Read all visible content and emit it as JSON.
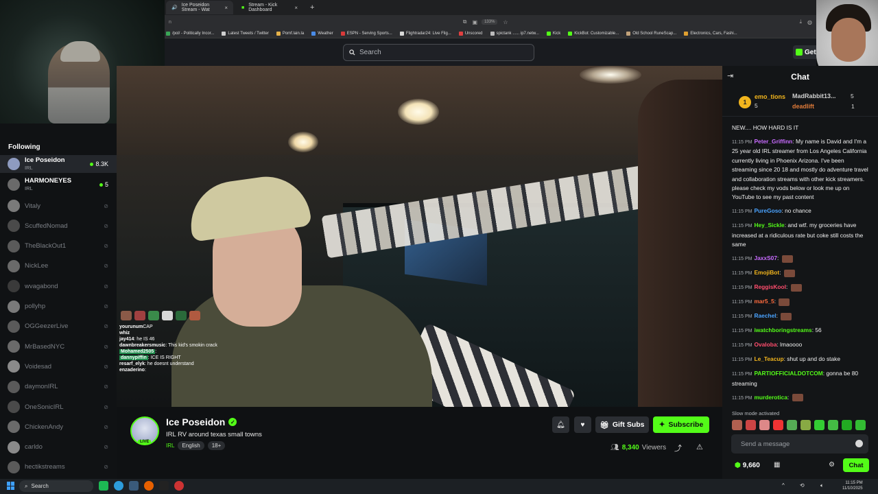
{
  "browser": {
    "tabs": [
      {
        "label": "Ice Poseidon Stream - Wat",
        "close": "×"
      },
      {
        "label": "Stream - Kick Dashboard",
        "close": "×"
      }
    ],
    "new_tab": "+",
    "zoom": "133%",
    "bookmarks": [
      {
        "label": "/pol/ - Politically Incor...",
        "color": "#3aa657"
      },
      {
        "label": "Latest Tweets / Twitter",
        "color": "#cfcfcf"
      },
      {
        "label": "Pomf.lain.la",
        "color": "#e6b24a"
      },
      {
        "label": "Weather",
        "color": "#4a8be6"
      },
      {
        "label": "ESPN - Serving Sports...",
        "color": "#d83a3a"
      },
      {
        "label": "Flightradar24: Live Flig...",
        "color": "#d8d8d8"
      },
      {
        "label": "Unscored",
        "color": "#e04040"
      },
      {
        "label": "spictank ...... ip7.netw...",
        "color": "#bbbbbb"
      },
      {
        "label": "Kick",
        "color": "#53fc18"
      },
      {
        "label": "KickBot: Customizable...",
        "color": "#53fc18"
      },
      {
        "label": "Old School RuneScap...",
        "color": "#c2a27a"
      },
      {
        "label": "Electronics, Cars, Fashi...",
        "color": "#e0a030"
      }
    ]
  },
  "header": {
    "search_placeholder": "Search",
    "get_label": "Get"
  },
  "sidebar": {
    "heading": "Following",
    "items": [
      {
        "name": "Ice Poseidon",
        "category": "IRL",
        "viewers": "8.3K",
        "live": true,
        "avatar": "#8e9bc0"
      },
      {
        "name": "HARMONEYES",
        "category": "IRL",
        "viewers": "5",
        "live": true,
        "avatar": "#6a6a6a"
      },
      {
        "name": "Vitaly",
        "avatar": "#7a7a7a"
      },
      {
        "name": "ScuffedNomad",
        "avatar": "#4a4a4a"
      },
      {
        "name": "TheBlackOut1",
        "avatar": "#5a5a5a"
      },
      {
        "name": "NickLee",
        "avatar": "#6a6a6a"
      },
      {
        "name": "wvagabond",
        "avatar": "#3a3a3a"
      },
      {
        "name": "pollyhp",
        "avatar": "#7a7a7a"
      },
      {
        "name": "OGGeezerLive",
        "avatar": "#5a5a5a"
      },
      {
        "name": "MrBasedNYC",
        "avatar": "#6a6a6a"
      },
      {
        "name": "Voidesad",
        "avatar": "#8a8a8a"
      },
      {
        "name": "daymonIRL",
        "avatar": "#5a5a5a"
      },
      {
        "name": "OneSonicIRL",
        "avatar": "#4a4a4a"
      },
      {
        "name": "ChickenAndy",
        "avatar": "#6a6a6a"
      },
      {
        "name": "carldo",
        "avatar": "#8a8a8a"
      },
      {
        "name": "hectikstreams",
        "avatar": "#5a5a5a"
      }
    ]
  },
  "overlay_chat": [
    {
      "user": "yourunum",
      "text": "CAP"
    },
    {
      "user": "whiz",
      "text": ""
    },
    {
      "user": "jay414",
      "text": ": he IS 46"
    },
    {
      "user": "dawnbreakersmusic",
      "text": ": This kid's smokin crack"
    },
    {
      "user": "Mohamed2505",
      "text": ":"
    },
    {
      "user": "dannypiffin",
      "text": ": ICE IS RIGHT"
    },
    {
      "user": "resarf_elyk",
      "text": ": he doesnt understand"
    },
    {
      "user": "enzaderino",
      "text": ":"
    }
  ],
  "stream": {
    "streamer": "Ice Poseidon",
    "live_badge": "LIVE",
    "title": "IRL RV around texas small towns",
    "category": "IRL",
    "tags": [
      "English",
      "18+"
    ],
    "gift_label": "Gift Subs",
    "subscribe_label": "Subscribe",
    "viewers": "8,340",
    "viewers_label": "Viewers"
  },
  "chat": {
    "title": "Chat",
    "leaderboard": {
      "rank": "1",
      "first": {
        "name": "emo_tions",
        "value": "5"
      },
      "second": {
        "name": "MadRabbit13...",
        "value": "5"
      },
      "third": {
        "name": "deadlift",
        "value": "1"
      }
    },
    "messages": [
      {
        "time": "",
        "user": "",
        "color": "#ffffff",
        "text": "NEW.... HOW HARD IS IT"
      },
      {
        "time": "11:15 PM",
        "user": "Peter_Griffinn",
        "color": "#c86bff",
        "text": "My name is David and I'm a 25 year old IRL streamer from Los Angeles California currently living in Phoenix Arizona. I've been streaming since 20 18 and mostly do adventure travel and collaboration streams with other kick streamers. please check my vods below or look me up on YouTube to see my past content"
      },
      {
        "time": "11:15 PM",
        "user": "PureGoso",
        "color": "#4aa3ff",
        "text": "no chance"
      },
      {
        "time": "11:15 PM",
        "user": "Hey_Sickle",
        "color": "#53fc18",
        "text": "and wtf. my groceries have increased at a ridiculous rate but coke still costs the same"
      },
      {
        "time": "11:15 PM",
        "user": "JaxxS07",
        "color": "#c86bff",
        "text": ""
      },
      {
        "time": "11:15 PM",
        "user": "EmojiBot",
        "color": "#f2b51d",
        "text": ""
      },
      {
        "time": "11:15 PM",
        "user": "ReggisKool",
        "color": "#ff4d6d",
        "text": ""
      },
      {
        "time": "11:15 PM",
        "user": "mar5_5",
        "color": "#ff6b3d",
        "text": ""
      },
      {
        "time": "11:15 PM",
        "user": "Raechel",
        "color": "#4aa3ff",
        "text": ""
      },
      {
        "time": "11:15 PM",
        "user": "iwatchboringstreams",
        "color": "#53fc18",
        "text": "56"
      },
      {
        "time": "11:15 PM",
        "user": "Ovaloba",
        "color": "#ff4d6d",
        "text": "lmaoooo"
      },
      {
        "time": "11:15 PM",
        "user": "Le_Teacup",
        "color": "#f2b51d",
        "text": "shut up and do stake"
      },
      {
        "time": "11:15 PM",
        "user": "PARTIOFFICIALDOTCOM",
        "color": "#53fc18",
        "text": "gonna be 80 streaming"
      },
      {
        "time": "11:15 PM",
        "user": "murderotica",
        "color": "#53fc18",
        "text": ""
      }
    ],
    "slow_mode": "Slow mode activated",
    "input_placeholder": "Send a message",
    "points": "9,660",
    "chat_button": "Chat"
  },
  "taskbar": {
    "search": "Search",
    "time": "11:15 PM",
    "date": "11/10/2025"
  }
}
